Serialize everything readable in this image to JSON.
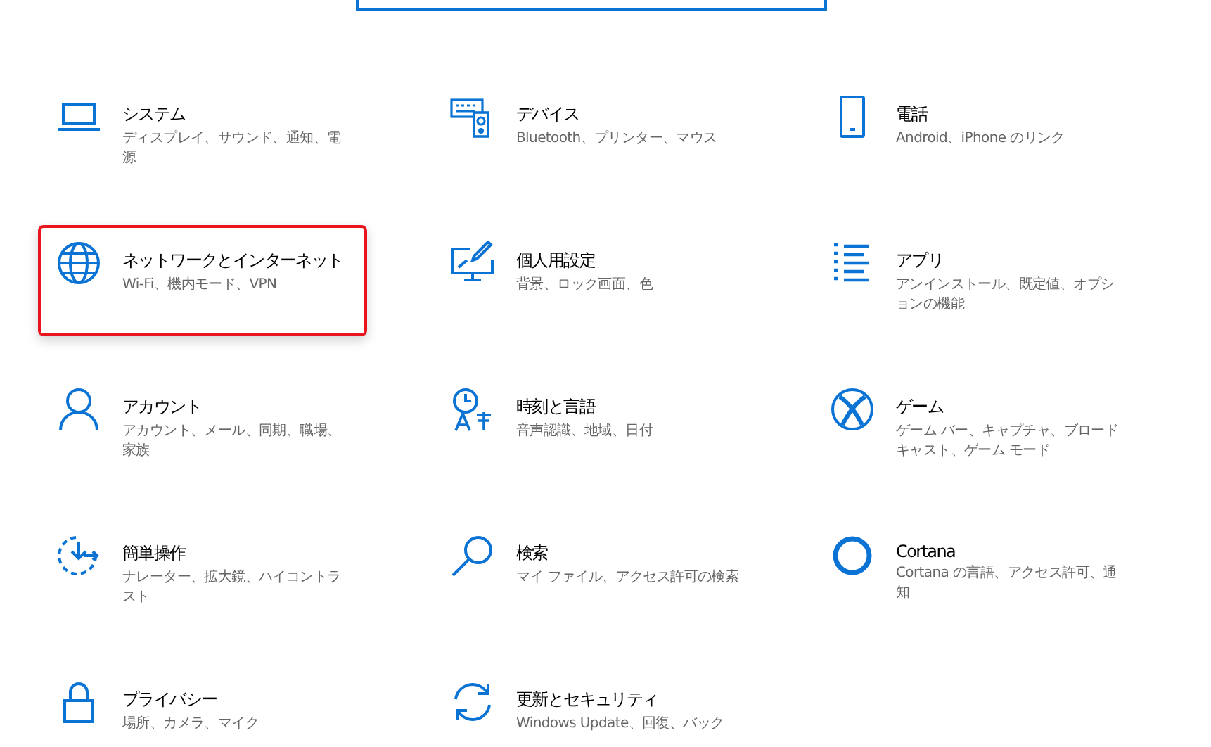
{
  "search": {
    "kind": "field"
  },
  "categories": [
    {
      "kind": "laptop",
      "title": "システム",
      "description": "ディスプレイ、サウンド、通知、電源",
      "highlighted": false
    },
    {
      "kind": "devices",
      "title": "デバイス",
      "description": "Bluetooth、プリンター、マウス",
      "highlighted": false
    },
    {
      "kind": "phone",
      "title": "電話",
      "description": "Android、iPhone のリンク",
      "highlighted": false
    },
    {
      "kind": "globe",
      "title": "ネットワークとインターネット",
      "description": "Wi-Fi、機内モード、VPN",
      "highlighted": true
    },
    {
      "kind": "brush",
      "title": "個人用設定",
      "description": "背景、ロック画面、色",
      "highlighted": false
    },
    {
      "kind": "list",
      "title": "アプリ",
      "description": "アンインストール、既定値、オプションの機能",
      "highlighted": false
    },
    {
      "kind": "person",
      "title": "アカウント",
      "description": "アカウント、メール、同期、職場、家族",
      "highlighted": false
    },
    {
      "kind": "clock",
      "title": "時刻と言語",
      "description": "音声認識、地域、日付",
      "highlighted": false
    },
    {
      "kind": "xbox",
      "title": "ゲーム",
      "description": "ゲーム バー、キャプチャ、ブロードキャスト、ゲーム モード",
      "highlighted": false
    },
    {
      "kind": "ease",
      "title": "簡単操作",
      "description": "ナレーター、拡大鏡、ハイコントラスト",
      "highlighted": false
    },
    {
      "kind": "search",
      "title": "検索",
      "description": "マイ ファイル、アクセス許可の検索",
      "highlighted": false
    },
    {
      "kind": "ring",
      "title": "Cortana",
      "description": "Cortana の言語、アクセス許可、通知",
      "highlighted": false
    },
    {
      "kind": "lock",
      "title": "プライバシー",
      "description": "場所、カメラ、マイク",
      "highlighted": false
    },
    {
      "kind": "sync",
      "title": "更新とセキュリティ",
      "description": "Windows Update、回復、バック",
      "highlighted": false
    }
  ]
}
